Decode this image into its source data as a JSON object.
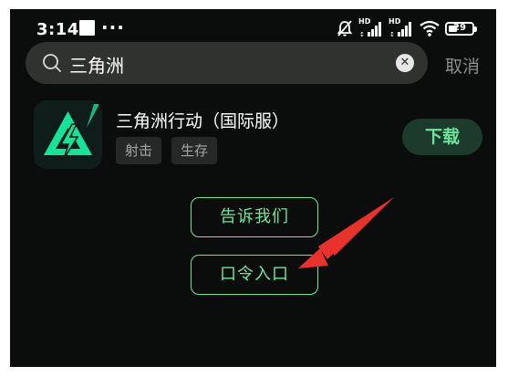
{
  "status_bar": {
    "time": "3:14",
    "more": "···",
    "hd_1": "HD",
    "hd_2": "HD",
    "battery_level": "29",
    "icons": [
      "square-notification-icon",
      "bell-muted-icon",
      "signal-hd-icon",
      "signal-hd-icon",
      "wifi-icon",
      "battery-icon"
    ]
  },
  "search": {
    "query": "三角洲",
    "cancel_label": "取消",
    "clear_icon": "close-circle-icon"
  },
  "result": {
    "title": "三角洲行动（国际服）",
    "tags": [
      "射击",
      "生存"
    ],
    "download_label": "下载"
  },
  "actions": {
    "tell_us_label": "告诉我们",
    "code_entry_label": "口令入口"
  },
  "colors": {
    "background": "#0b0d0c",
    "accent_green": "#6ee79b",
    "annotation_red": "#e8322b"
  }
}
